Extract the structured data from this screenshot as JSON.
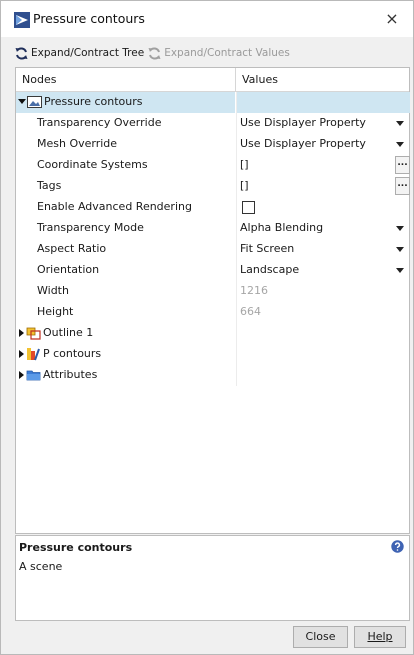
{
  "window": {
    "title": "Pressure contours",
    "close_glyph": "×"
  },
  "toolbar": {
    "expand_tree": "Expand/Contract Tree",
    "expand_values": "Expand/Contract Values"
  },
  "tree": {
    "headers": {
      "nodes": "Nodes",
      "values": "Values"
    },
    "root": {
      "label": "Pressure contours"
    },
    "properties": [
      {
        "label": "Transparency Override",
        "value": "Use Displayer Property"
      },
      {
        "label": "Mesh Override",
        "value": "Use Displayer Property"
      },
      {
        "label": "Coordinate Systems",
        "value": "[]",
        "button": "..."
      },
      {
        "label": "Tags",
        "value": "[]",
        "button": "..."
      },
      {
        "label": "Enable Advanced Rendering",
        "value": ""
      },
      {
        "label": "Transparency Mode",
        "value": "Alpha Blending"
      },
      {
        "label": "Aspect Ratio",
        "value": "Fit Screen"
      },
      {
        "label": "Orientation",
        "value": "Landscape"
      },
      {
        "label": "Width",
        "value": "1216"
      },
      {
        "label": "Height",
        "value": "664"
      }
    ],
    "children": [
      {
        "label": "Outline 1",
        "icon": "outline-displayer-icon"
      },
      {
        "label": "P contours",
        "icon": "scalar-displayer-icon"
      },
      {
        "label": "Attributes",
        "icon": "folder-icon"
      }
    ]
  },
  "description": {
    "title": "Pressure contours",
    "text": "A scene"
  },
  "buttons": {
    "close": "Close",
    "help": "Help"
  },
  "colors": {
    "selection": "#cfe6f2",
    "disabled_text": "#a6a6a6",
    "help_icon": "#3f63b3"
  }
}
